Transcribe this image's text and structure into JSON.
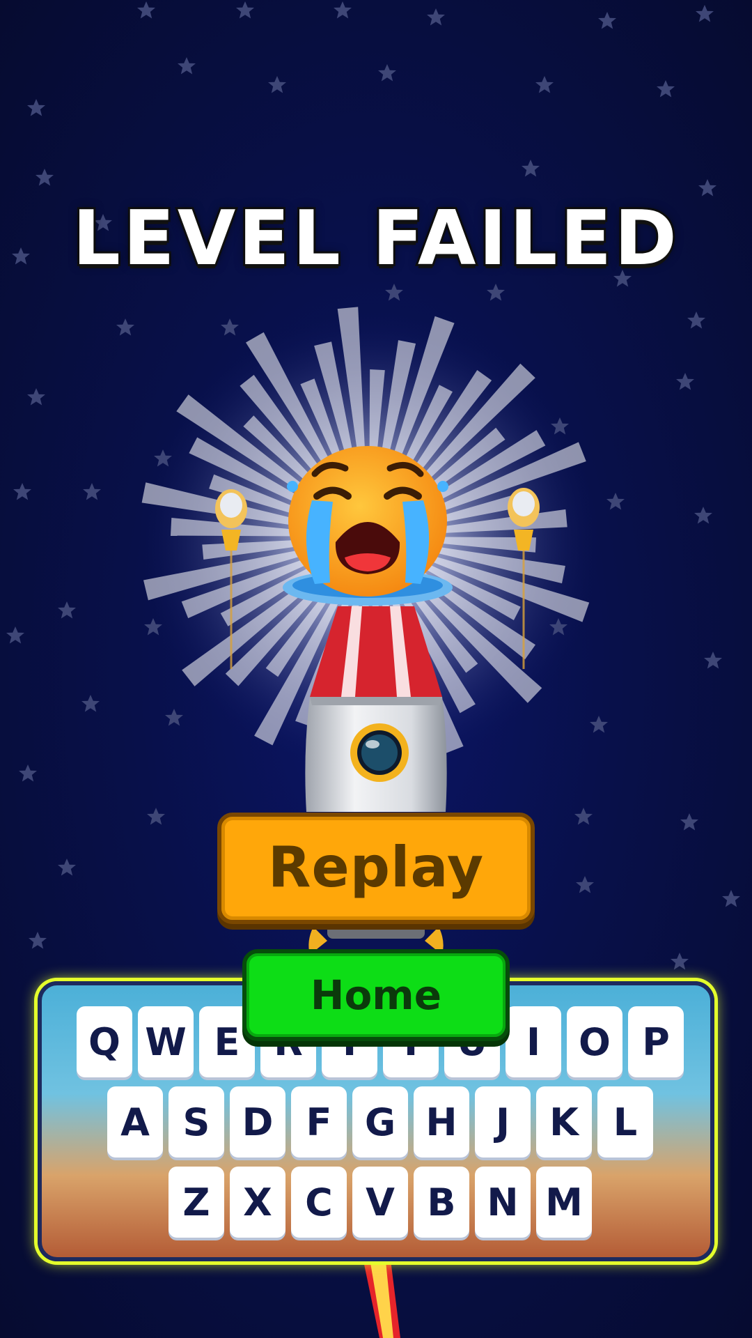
{
  "screen": {
    "title": "LEVEL FAILED"
  },
  "buttons": {
    "replay_label": "Replay",
    "home_label": "Home"
  },
  "keyboard": {
    "rows": [
      [
        "Q",
        "W",
        "E",
        "R",
        "T",
        "Y",
        "U",
        "I",
        "O",
        "P"
      ],
      [
        "A",
        "S",
        "D",
        "F",
        "G",
        "H",
        "J",
        "K",
        "L"
      ],
      [
        "Z",
        "X",
        "C",
        "V",
        "B",
        "N",
        "M"
      ]
    ]
  },
  "colors": {
    "background": "#08104a",
    "replay_button": "#ffa70a",
    "home_button": "#0ddd16",
    "keyboard_glow": "#e4ff2c",
    "key_text": "#121a4a"
  },
  "icons": [
    "star-icon",
    "crying-face-icon",
    "rocket-icon",
    "satellite-icon"
  ]
}
